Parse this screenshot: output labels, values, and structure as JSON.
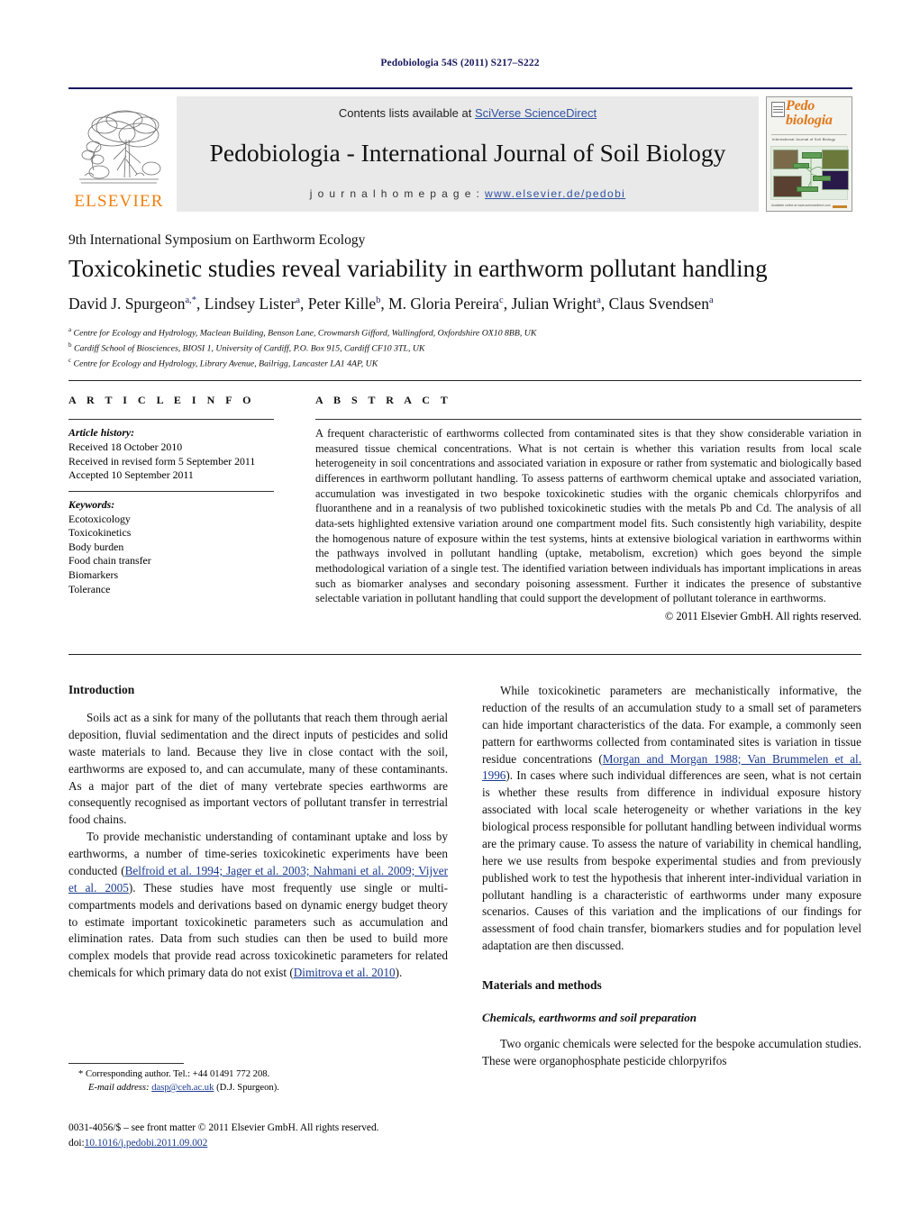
{
  "running_head": "Pedobiologia 54S (2011) S217–S222",
  "masthead": {
    "contents_prefix": "Contents lists available at ",
    "contents_link": "SciVerse ScienceDirect",
    "journal_name": "Pedobiologia - International Journal of Soil Biology",
    "homepage_prefix": "j o u r n a l   h o m e p a g e :  ",
    "homepage_url": "www.elsevier.de/pedobi",
    "publisher_wordmark": "ELSEVIER",
    "publisher_logo_icon": "elsevier-tree-icon",
    "cover": {
      "title_line1": "Pedo",
      "title_line2": "biologia",
      "subtitle": "International Journal of Soil Biology",
      "footer_text": "Available online at www.sciencedirect.com"
    }
  },
  "symposium": "9th International Symposium on Earthworm Ecology",
  "title": "Toxicokinetic studies reveal variability in earthworm pollutant handling",
  "authors": [
    {
      "name": "David J. Spurgeon",
      "marks": "a,*"
    },
    {
      "name": "Lindsey Lister",
      "marks": "a"
    },
    {
      "name": "Peter Kille",
      "marks": "b"
    },
    {
      "name": "M. Gloria Pereira",
      "marks": "c"
    },
    {
      "name": "Julian Wright",
      "marks": "a"
    },
    {
      "name": "Claus Svendsen",
      "marks": "a"
    }
  ],
  "affiliations": [
    {
      "mark": "a",
      "text": "Centre for Ecology and Hydrology, Maclean Building, Benson Lane, Crowmarsh Gifford, Wallingford, Oxfordshire OX10 8BB, UK"
    },
    {
      "mark": "b",
      "text": "Cardiff School of Biosciences, BIOSI 1, University of Cardiff, P.O. Box 915, Cardiff CF10 3TL, UK"
    },
    {
      "mark": "c",
      "text": "Centre for Ecology and Hydrology, Library Avenue, Bailrigg, Lancaster LA1 4AP, UK"
    }
  ],
  "article_info": {
    "heading": "A R T I C L E   I N F O",
    "history_label": "Article history:",
    "history": [
      "Received 18 October 2010",
      "Received in revised form 5 September 2011",
      "Accepted 10 September 2011"
    ],
    "keywords_label": "Keywords:",
    "keywords": [
      "Ecotoxicology",
      "Toxicokinetics",
      "Body burden",
      "Food chain transfer",
      "Biomarkers",
      "Tolerance"
    ]
  },
  "abstract": {
    "heading": "A B S T R A C T",
    "text": "A frequent characteristic of earthworms collected from contaminated sites is that they show considerable variation in measured tissue chemical concentrations. What is not certain is whether this variation results from local scale heterogeneity in soil concentrations and associated variation in exposure or rather from systematic and biologically based differences in earthworm pollutant handling. To assess patterns of earthworm chemical uptake and associated variation, accumulation was investigated in two bespoke toxicokinetic studies with the organic chemicals chlorpyrifos and fluoranthene and in a reanalysis of two published toxicokinetic studies with the metals Pb and Cd. The analysis of all data-sets highlighted extensive variation around one compartment model fits. Such consistently high variability, despite the homogenous nature of exposure within the test systems, hints at extensive biological variation in earthworms within the pathways involved in pollutant handling (uptake, metabolism, excretion) which goes beyond the simple methodological variation of a single test. The identified variation between individuals has important implications in areas such as biomarker analyses and secondary poisoning assessment. Further it indicates the presence of substantive selectable variation in pollutant handling that could support the development of pollutant tolerance in earthworms.",
    "copyright": "© 2011 Elsevier GmbH. All rights reserved."
  },
  "body": {
    "intro_heading": "Introduction",
    "intro_p1": "Soils act as a sink for many of the pollutants that reach them through aerial deposition, fluvial sedimentation and the direct inputs of pesticides and solid waste materials to land. Because they live in close contact with the soil, earthworms are exposed to, and can accumulate, many of these contaminants. As a major part of the diet of many vertebrate species earthworms are consequently recognised as important vectors of pollutant transfer in terrestrial food chains.",
    "intro_p2_a": "To provide mechanistic understanding of contaminant uptake and loss by earthworms, a number of time-series toxicokinetic experiments have been conducted (",
    "intro_p2_cite1": "Belfroid et al. 1994; Jager et al. 2003; Nahmani et al. 2009; Vijver et al. 2005",
    "intro_p2_b": "). These studies have most frequently use single or multi-compartments models and derivations based on dynamic energy budget theory to estimate important toxicokinetic parameters such as accumulation and elimination rates. Data from such studies can then be used to build more complex models that provide read across toxicokinetic parameters for related chemicals for which primary data do not exist (",
    "intro_p2_cite2": "Dimitrova et al. 2010",
    "intro_p2_c": ").",
    "right_p1_a": "While toxicokinetic parameters are mechanistically informative, the reduction of the results of an accumulation study to a small set of parameters can hide important characteristics of the data. For example, a commonly seen pattern for earthworms collected from contaminated sites is variation in tissue residue concentrations (",
    "right_p1_cite": "Morgan and Morgan 1988; Van Brummelen et al. 1996",
    "right_p1_b": "). In cases where such individual differences are seen, what is not certain is whether these results from difference in individual exposure history associated with local scale heterogeneity or whether variations in the key biological process responsible for pollutant handling between individual worms are the primary cause. To assess the nature of variability in chemical handling, here we use results from bespoke experimental studies and from previously published work to test the hypothesis that inherent inter-individual variation in pollutant handling is a characteristic of earthworms under many exposure scenarios. Causes of this variation and the implications of our findings for assessment of food chain transfer, biomarkers studies and for population level adaptation are then discussed.",
    "methods_heading": "Materials and methods",
    "methods_subheading": "Chemicals, earthworms and soil preparation",
    "methods_p1": "Two organic chemicals were selected for the bespoke accumulation studies. These were organophosphate pesticide chlorpyrifos"
  },
  "footnote": {
    "corresponding": "* Corresponding author. Tel.: +44 01491 772 208.",
    "email_label": "E-mail address:",
    "email": "dasp@ceh.ac.uk",
    "email_suffix": "(D.J. Spurgeon)."
  },
  "footer": {
    "issn_line": "0031-4056/$ – see front matter © 2011 Elsevier GmbH. All rights reserved.",
    "doi_prefix": "doi:",
    "doi": "10.1016/j.pedobi.2011.09.002"
  },
  "colors": {
    "link": "#1a3a8f",
    "accent_orange": "#f08010",
    "navy": "#1a1a5e",
    "band_gray": "#e9e9e9"
  }
}
